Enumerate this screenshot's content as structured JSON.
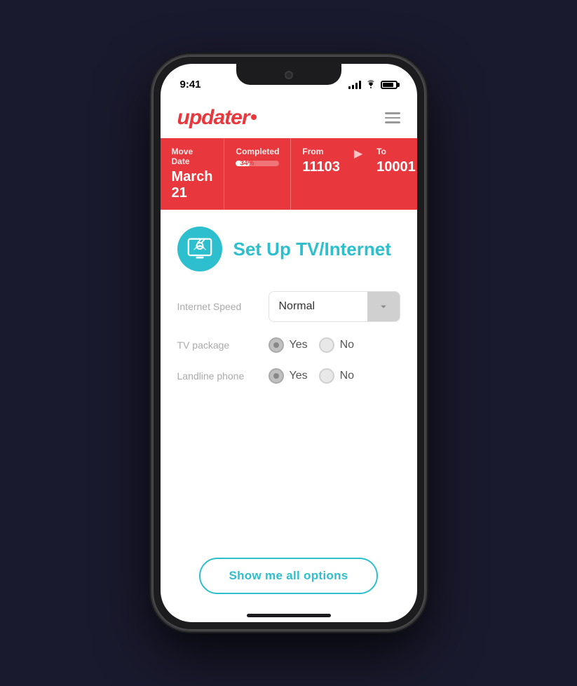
{
  "status_bar": {
    "time": "9:41"
  },
  "header": {
    "logo": "updater",
    "menu_label": "menu"
  },
  "stats": {
    "move_date_label": "Move Date",
    "move_date_value": "March 21",
    "completed_label": "Completed",
    "completed_percent": "34%",
    "completed_progress": 34,
    "from_label": "From",
    "from_zip": "11103",
    "to_label": "To",
    "to_zip": "10001"
  },
  "section": {
    "title": "Set Up TV/Internet"
  },
  "form": {
    "internet_speed_label": "Internet Speed",
    "internet_speed_value": "Normal",
    "tv_package_label": "TV package",
    "yes_label": "Yes",
    "no_label": "No",
    "landline_label": "Landline phone"
  },
  "cta": {
    "button_label": "Show me all options"
  }
}
